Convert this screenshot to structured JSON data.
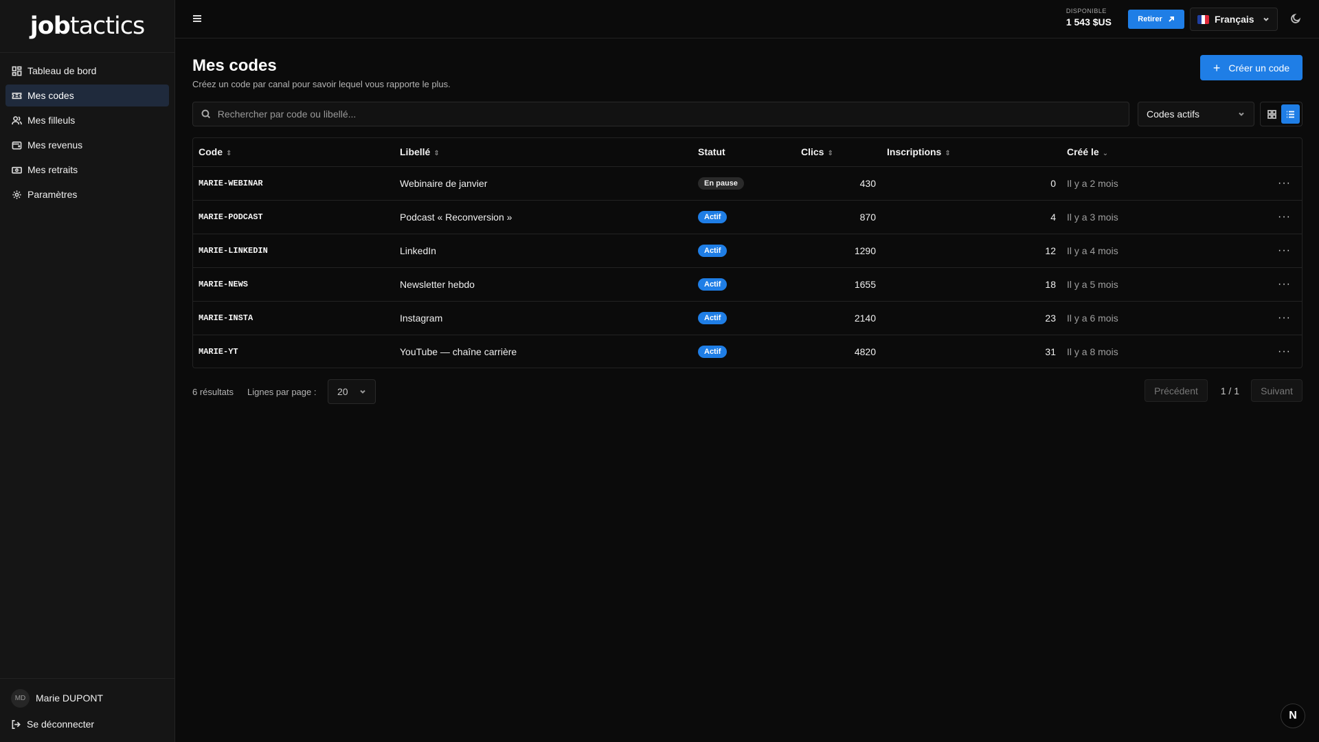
{
  "brand": {
    "bold": "job",
    "light": "tactics"
  },
  "sidebar": {
    "items": [
      {
        "label": "Tableau de bord",
        "icon": "dashboard-icon"
      },
      {
        "label": "Mes codes",
        "icon": "ticket-icon",
        "active": true
      },
      {
        "label": "Mes filleuls",
        "icon": "users-icon"
      },
      {
        "label": "Mes revenus",
        "icon": "wallet-icon"
      },
      {
        "label": "Mes retraits",
        "icon": "banknote-icon"
      },
      {
        "label": "Paramètres",
        "icon": "gear-icon"
      }
    ],
    "user": {
      "initials": "MD",
      "name": "Marie DUPONT"
    },
    "logout_label": "Se déconnecter"
  },
  "topbar": {
    "balance_label": "DISPONIBLE",
    "balance_value": "1 543 $US",
    "withdraw_label": "Retirer",
    "language": "Français"
  },
  "page": {
    "title": "Mes codes",
    "subtitle": "Créez un code par canal pour savoir lequel vous rapporte le plus.",
    "create_label": "Créer un code",
    "search_placeholder": "Rechercher par code ou libellé...",
    "filter_value": "Codes actifs"
  },
  "table": {
    "headers": {
      "code": "Code",
      "label": "Libellé",
      "status": "Statut",
      "clicks": "Clics",
      "signups": "Inscriptions",
      "created": "Créé le"
    },
    "rows": [
      {
        "code": "MARIE-WEBINAR",
        "label": "Webinaire de janvier",
        "status": "En pause",
        "clicks": "430",
        "signups": "0",
        "created": "Il y a 2 mois"
      },
      {
        "code": "MARIE-PODCAST",
        "label": "Podcast « Reconversion »",
        "status": "Actif",
        "clicks": "870",
        "signups": "4",
        "created": "Il y a 3 mois"
      },
      {
        "code": "MARIE-LINKEDIN",
        "label": "LinkedIn",
        "status": "Actif",
        "clicks": "1290",
        "signups": "12",
        "created": "Il y a 4 mois"
      },
      {
        "code": "MARIE-NEWS",
        "label": "Newsletter hebdo",
        "status": "Actif",
        "clicks": "1655",
        "signups": "18",
        "created": "Il y a 5 mois"
      },
      {
        "code": "MARIE-INSTA",
        "label": "Instagram",
        "status": "Actif",
        "clicks": "2140",
        "signups": "23",
        "created": "Il y a 6 mois"
      },
      {
        "code": "MARIE-YT",
        "label": "YouTube — chaîne carrière",
        "status": "Actif",
        "clicks": "4820",
        "signups": "31",
        "created": "Il y a 8 mois"
      }
    ]
  },
  "pagination": {
    "results": "6 résultats",
    "rows_label": "Lignes par page :",
    "rows_value": "20",
    "prev_label": "Précédent",
    "page": "1 / 1",
    "next_label": "Suivant"
  },
  "corner_label": "N",
  "colors": {
    "accent": "#1f7ee6",
    "background": "#0b0b0b",
    "sidebar": "#151515"
  }
}
